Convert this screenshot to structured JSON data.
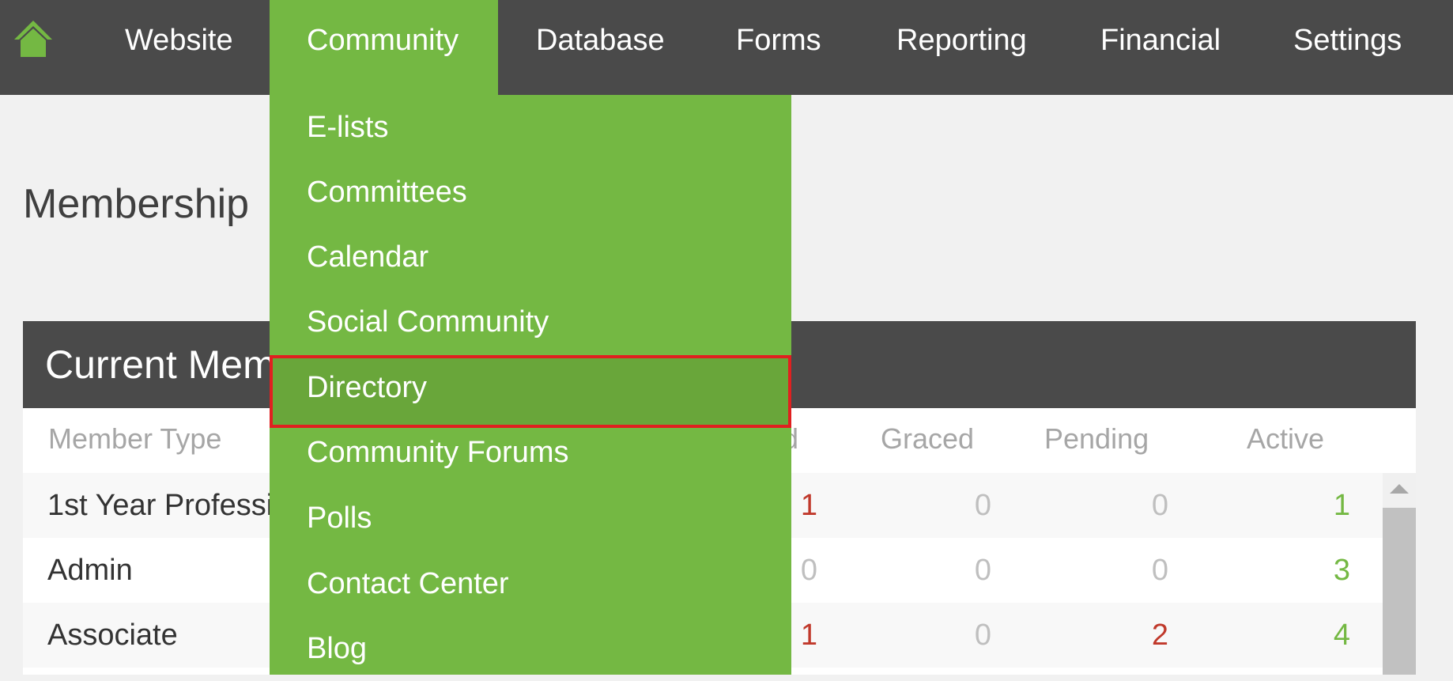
{
  "nav": {
    "home_icon": "home-icon",
    "items": [
      {
        "label": "Website"
      },
      {
        "label": "Community"
      },
      {
        "label": "Database"
      },
      {
        "label": "Forms"
      },
      {
        "label": "Reporting"
      },
      {
        "label": "Financial"
      },
      {
        "label": "Settings"
      }
    ],
    "active_item": "Community"
  },
  "dropdown": {
    "items": [
      {
        "label": "E-lists"
      },
      {
        "label": "Committees"
      },
      {
        "label": "Calendar"
      },
      {
        "label": "Social Community"
      },
      {
        "label": "Directory"
      },
      {
        "label": "Community Forums"
      },
      {
        "label": "Polls"
      },
      {
        "label": "Contact Center"
      },
      {
        "label": "Blog"
      }
    ],
    "highlighted_item": "Directory"
  },
  "page": {
    "title": "Membership"
  },
  "panel": {
    "title": "Current Mem"
  },
  "table": {
    "headers": {
      "member_type": "Member Type",
      "col_partial": "d",
      "graced": "Graced",
      "pending": "Pending",
      "active": "Active"
    },
    "rows": [
      {
        "name": "1st Year Professi",
        "partial": "1",
        "graced": "0",
        "pending": "0",
        "active": "1"
      },
      {
        "name": "Admin",
        "partial": "0",
        "graced": "0",
        "pending": "0",
        "active": "3"
      },
      {
        "name": "Associate",
        "partial": "1",
        "graced": "0",
        "pending": "2",
        "active": "4"
      }
    ]
  },
  "colors": {
    "nav_bg": "#4a4a4a",
    "accent_green": "#74b843",
    "highlight_border": "#e02020",
    "negative_red": "#c0392b"
  }
}
